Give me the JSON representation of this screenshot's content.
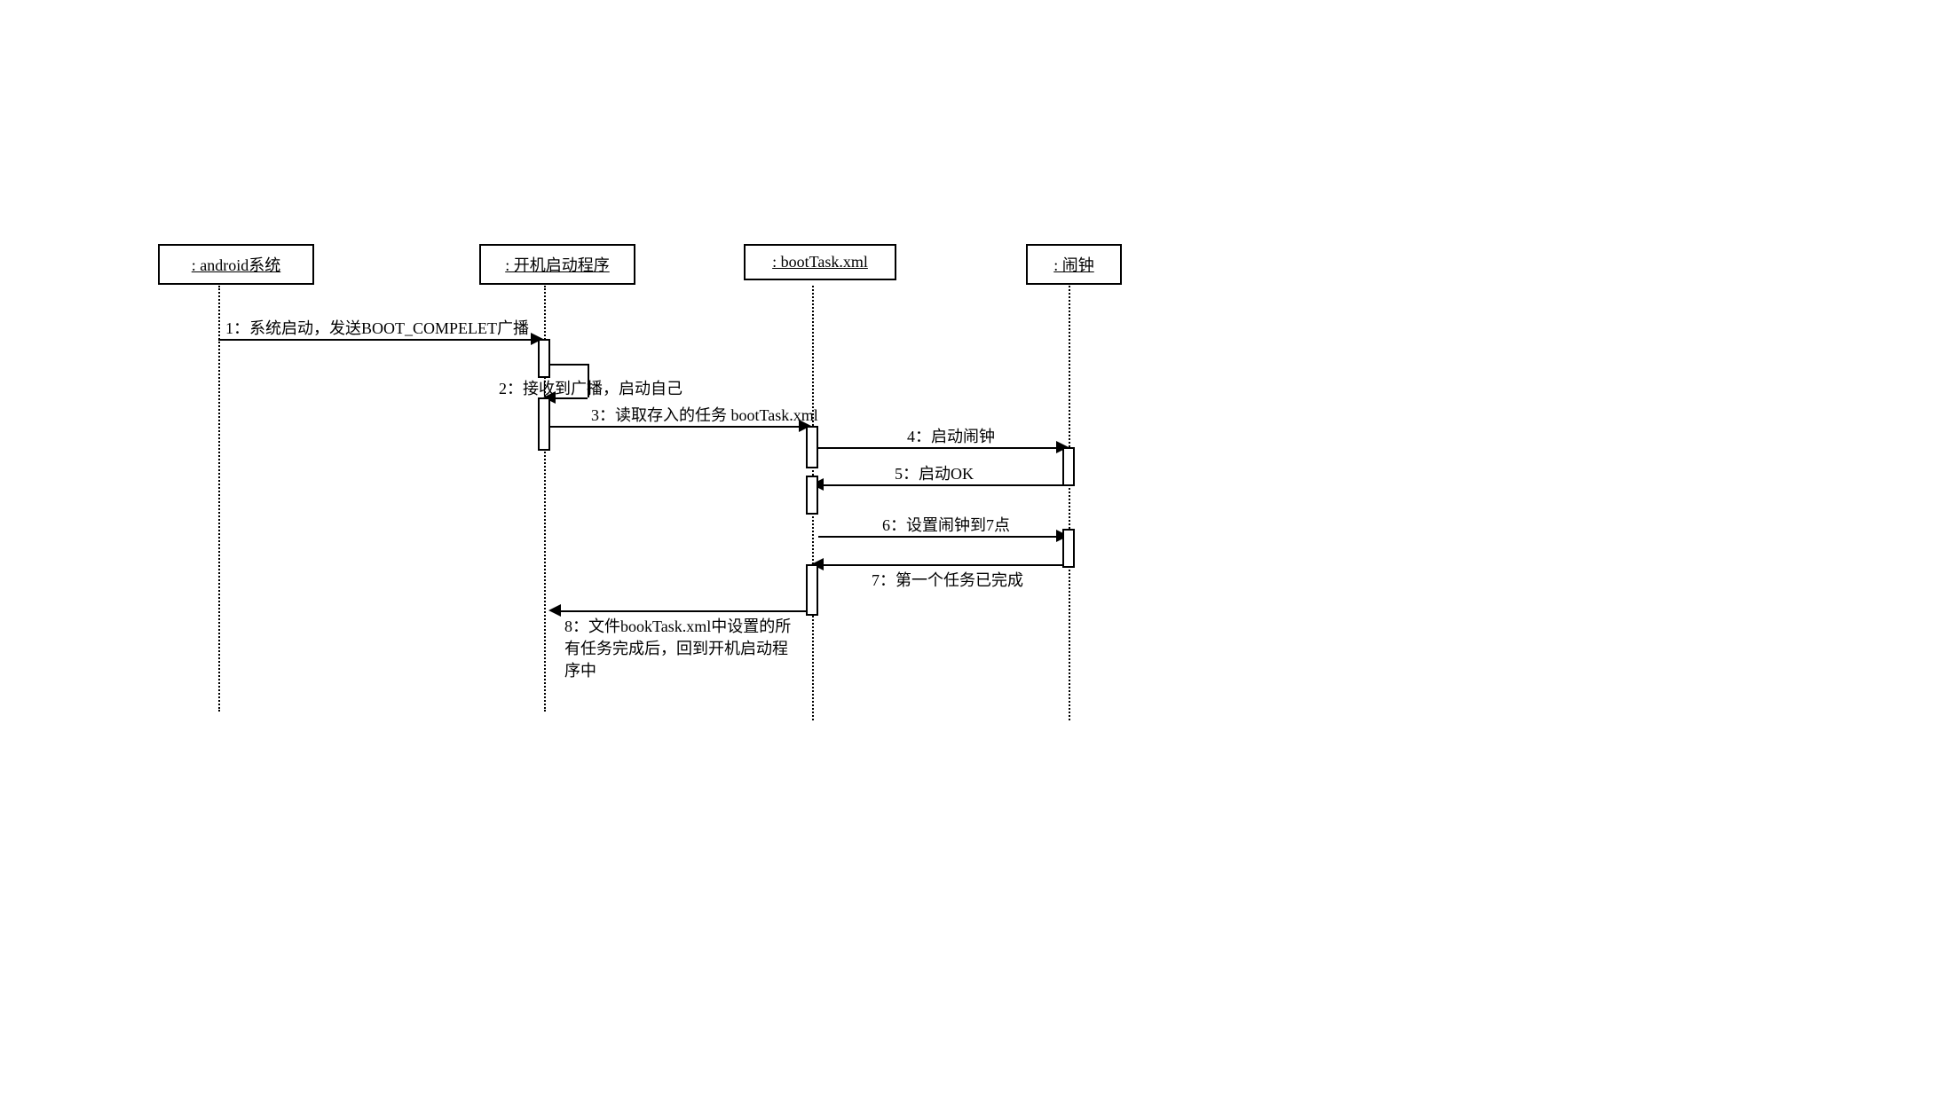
{
  "diagram_type": "sequence_diagram",
  "participants": {
    "p1": ": android系统",
    "p2": ": 开机启动程序",
    "p3": ": bootTask.xml",
    "p4": ": 闹钟"
  },
  "messages": {
    "m1": "1：系统启动，发送BOOT_COMPELET广播",
    "m2": "2：接收到广播，启动自己",
    "m3": "3：读取存入的任务 bootTask.xml",
    "m4": "4：启动闹钟",
    "m5": "5：启动OK",
    "m6": "6：设置闹钟到7点",
    "m7": "7：第一个任务已完成",
    "m8": "8：文件bookTask.xml中设置的所有任务完成后，回到开机启动程序中"
  }
}
